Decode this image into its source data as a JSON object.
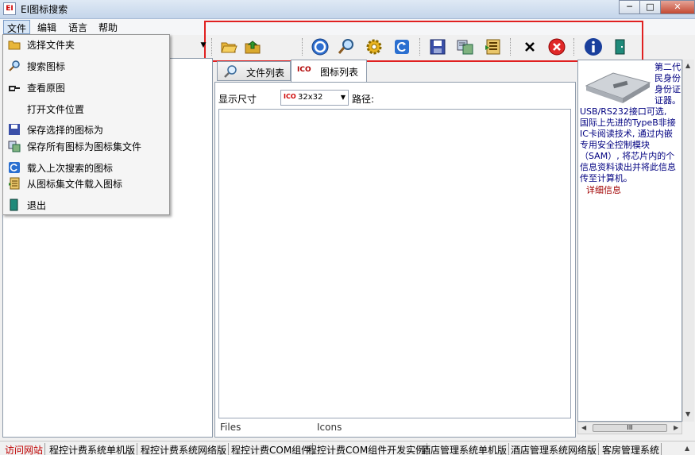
{
  "window": {
    "app_icon_text": "EI",
    "title": "EI图标搜索",
    "min": "─",
    "max": "□",
    "close": "✕"
  },
  "menubar": {
    "items": [
      "文件",
      "编辑",
      "语言",
      "帮助"
    ]
  },
  "toolbar": {
    "buttons": [
      "open-folder-icon",
      "load-folder-icon",
      "stop-icon",
      "search-icon",
      "settings-icon",
      "refresh-icon",
      "save-icon",
      "save-all-icon",
      "load-iconset-icon",
      "clear-icon",
      "exit-red-icon",
      "info-icon",
      "exit-door-icon"
    ],
    "accent": "#e02020"
  },
  "file_menu": {
    "items": [
      {
        "label": "选择文件夹",
        "icon": "folder-icon"
      },
      {
        "label": "搜索图标",
        "icon": "search-icon"
      },
      {
        "label": "查看原图",
        "icon": "pointing-hand-icon"
      },
      {
        "label": "打开文件位置",
        "icon": ""
      },
      {
        "label": "保存选择的图标为",
        "icon": "save-icon"
      },
      {
        "label": "保存所有图标为图标集文件",
        "icon": "save-all-icon"
      },
      {
        "label": "载入上次搜索的图标",
        "icon": "reload-icon"
      },
      {
        "label": "从图标集文件载入图标",
        "icon": "load-iconset-icon"
      },
      {
        "label": "退出",
        "icon": "exit-door-icon"
      }
    ]
  },
  "center": {
    "tabs": [
      {
        "label": "文件列表",
        "icon": "magnifier-icon"
      },
      {
        "label": "图标列表",
        "icon": "ico-icon",
        "icon_text": "ICO"
      }
    ],
    "size_label": "显示尺寸",
    "size_value": "32x32",
    "size_icon_text": "ICO",
    "path_label": "路径:",
    "columns": [
      "Files",
      "Icons"
    ]
  },
  "ad": {
    "lines": [
      "第二代",
      "民身份",
      "身份证",
      "证器。",
      "USB/RS232接口可选,",
      "国际上先进的TypeB非接",
      "IC卡阅读技术, 通过内嵌",
      "专用安全控制模块",
      "（SAM）, 将芯片内的个",
      "信息资料读出并将此信息",
      "传至计算机。"
    ],
    "link": "详细信息"
  },
  "scrollbar": {
    "thumb_grip": "III"
  },
  "linkbar": {
    "links": [
      "访问网站",
      "程控计费系统单机版",
      "程控计费系统网络版",
      "程控计费COM组件",
      "程控计费COM组件开发实例",
      "酒店管理系统单机版",
      "酒店管理系统网络版",
      "客房管理系统"
    ]
  }
}
